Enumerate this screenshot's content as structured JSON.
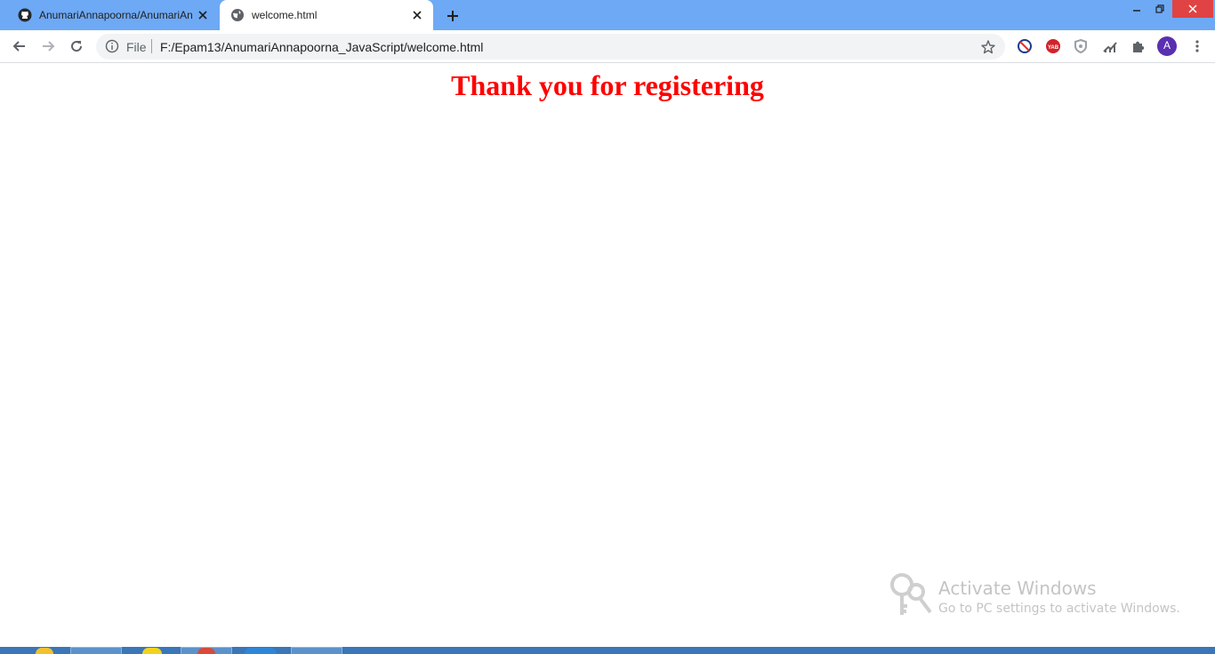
{
  "browser": {
    "tabs": [
      {
        "title": "AnumariAnnapoorna/AnumariAn",
        "favicon": "github-icon",
        "active": false
      },
      {
        "title": "welcome.html",
        "favicon": "globe-icon",
        "active": true
      }
    ],
    "address_bar": {
      "scheme_label": "File",
      "url": "F:/Epam13/AnumariAnnapoorna_JavaScript/welcome.html"
    },
    "profile_initial": "A",
    "extensions": [
      "block-icon",
      "yab-icon",
      "shield-icon",
      "analytics-icon",
      "puzzle-icon"
    ]
  },
  "page": {
    "heading": "Thank you for registering",
    "heading_color": "#ff0000"
  },
  "watermark": {
    "title": "Activate Windows",
    "subtitle": "Go to PC settings to activate Windows."
  },
  "colors": {
    "tabstrip": "#6ea9f5",
    "profile": "#5a2fb0",
    "taskbar": "#3a76b8"
  }
}
